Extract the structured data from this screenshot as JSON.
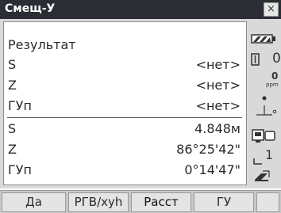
{
  "window": {
    "title": "Смещ-У",
    "close_label": "×"
  },
  "result": {
    "heading": "Результат",
    "rows_top": [
      {
        "label": "S",
        "value": "<нет>"
      },
      {
        "label": "Z",
        "value": "<нет>"
      },
      {
        "label": "ГУп",
        "value": "<нет>"
      }
    ],
    "rows_bottom": [
      {
        "label": "S",
        "value": "4.848м"
      },
      {
        "label": "Z",
        "value": "86°25'42\""
      },
      {
        "label": "ГУп",
        "value": "0°14'47\""
      }
    ]
  },
  "status_icons": {
    "battery": "battery-icon",
    "prism_constant": "0",
    "ppm_value": "0",
    "ppm_unit": "ppm",
    "target_icon": "reflector-icon",
    "instrument_icon": "instrument-icon",
    "face_label": "1",
    "face_icon": "face-icon",
    "input_icon": "input-mode-icon"
  },
  "softkeys": [
    {
      "label": "Да"
    },
    {
      "label": "РГВ/xyh"
    },
    {
      "label": "Расст"
    },
    {
      "label": "ГУ"
    },
    {
      "label": ""
    }
  ],
  "colors": {
    "titlebar": "#2a2e34",
    "panel": "#d9d9d9",
    "text": "#2a2a2a"
  }
}
